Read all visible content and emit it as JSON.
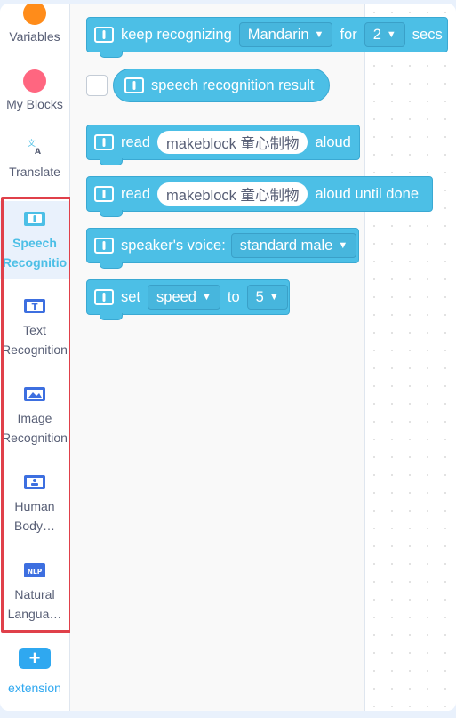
{
  "sidebar": {
    "categories": [
      {
        "label": "Variables",
        "color": "#ff8c1a"
      },
      {
        "label": "My Blocks",
        "color": "#ff6680"
      },
      {
        "label": "Translate"
      },
      {
        "label": "Speech Recognition",
        "active": true
      },
      {
        "label": "Text Recognition"
      },
      {
        "label": "Image Recognition"
      },
      {
        "label": "Human Body…"
      },
      {
        "label": "Natural Langua…",
        "icon_text": "NLP"
      }
    ],
    "extension_label": "extension"
  },
  "blocks": {
    "keep_recognizing": {
      "t1": "keep recognizing",
      "lang": "Mandarin",
      "t2": "for",
      "secs": "2",
      "t3": "secs"
    },
    "result": {
      "label": "speech recognition result"
    },
    "read": {
      "t1": "read",
      "text": "makeblock 童心制物",
      "t2": "aloud"
    },
    "read_until": {
      "t1": "read",
      "text": "makeblock 童心制物",
      "t2": "aloud until done"
    },
    "voice": {
      "t1": "speaker's voice:",
      "value": "standard male"
    },
    "set": {
      "t1": "set",
      "param": "speed",
      "t2": "to",
      "value": "5"
    }
  },
  "colors": {
    "block": "#4cbfe6",
    "highlight": "#e0404a",
    "active_text": "#4cbfe6"
  }
}
